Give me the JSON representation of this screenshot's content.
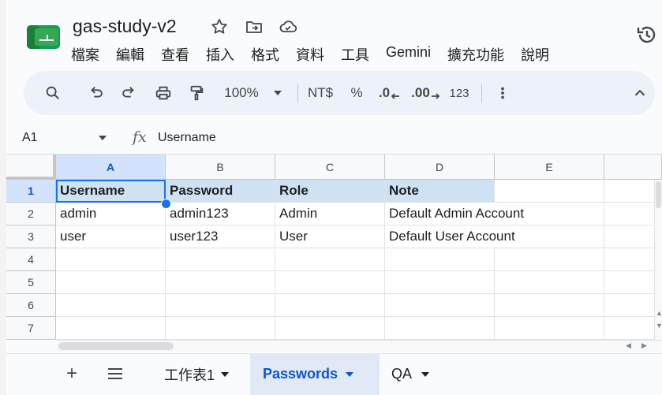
{
  "document": {
    "title": "gas-study-v2"
  },
  "menu": [
    "檔案",
    "編輯",
    "查看",
    "插入",
    "格式",
    "資料",
    "工具",
    "Gemini",
    "擴充功能",
    "說明"
  ],
  "toolbar": {
    "zoom": "100%",
    "currency": "NT$",
    "percent": "%",
    "dec_decrease": ".0",
    "dec_increase": ".00",
    "number_format": "123"
  },
  "formula_bar": {
    "cell_ref": "A1",
    "fx": "fx",
    "value": "Username"
  },
  "columns": [
    "A",
    "B",
    "C",
    "D",
    "E"
  ],
  "rows": [
    "1",
    "2",
    "3",
    "4",
    "5",
    "6",
    "7"
  ],
  "cells": [
    [
      "Username",
      "Password",
      "Role",
      "Note"
    ],
    [
      "admin",
      "admin123",
      "Admin",
      "Default Admin Account"
    ],
    [
      "user",
      "user123",
      "User",
      "Default User Account"
    ]
  ],
  "sheets": [
    {
      "name": "工作表1",
      "active": false
    },
    {
      "name": "Passwords",
      "active": true
    },
    {
      "name": "QA",
      "active": false
    }
  ],
  "colors": {
    "accent": "#0b57d0",
    "selection": "#1a73e8",
    "header_fill": "#cfe2f3"
  }
}
